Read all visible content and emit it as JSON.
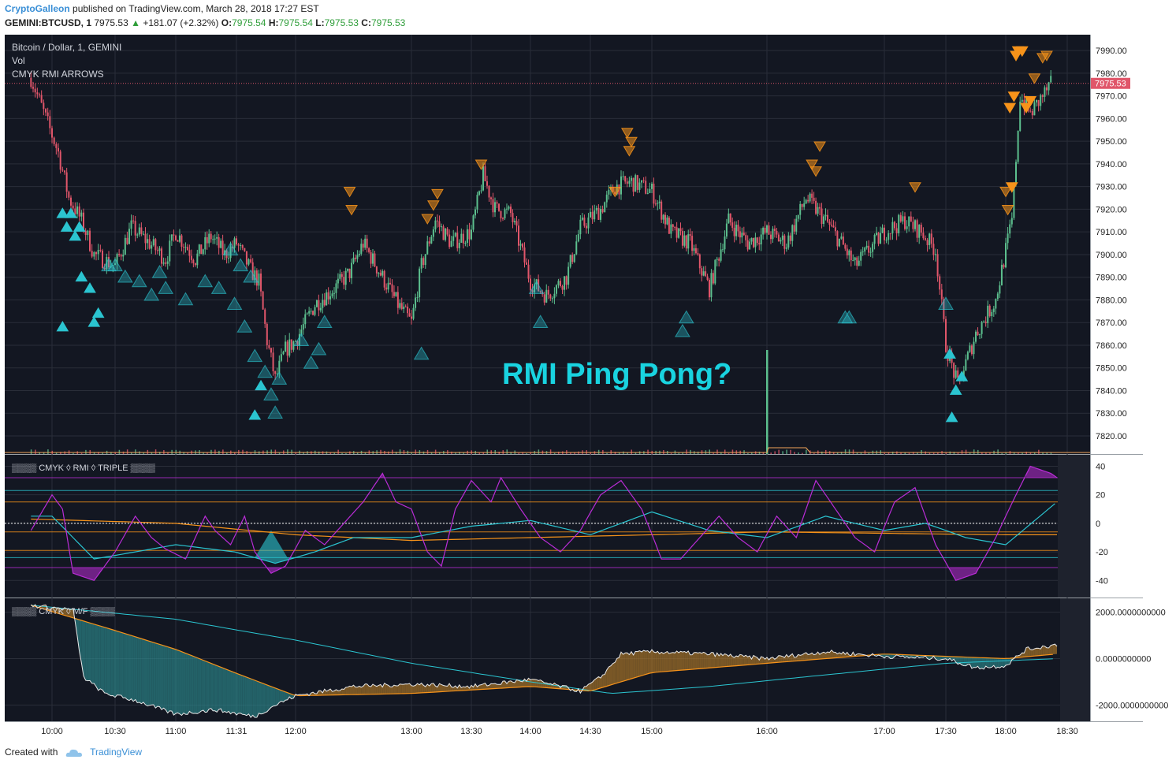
{
  "header": {
    "author": "CryptoGalleon",
    "published": "published on TradingView.com, March 28, 2018 17:27 EST",
    "symbol": "GEMINI:BTCUSD, 1",
    "last": "7975.53",
    "change": "+181.07 (+2.32%)",
    "o_label": "O:",
    "o": "7975.54",
    "h_label": "H:",
    "h": "7975.54",
    "l_label": "L:",
    "l": "7975.53",
    "c_label": "C:",
    "c": "7975.53"
  },
  "legend": {
    "main": "Bitcoin / Dollar, 1, GEMINI",
    "vol": "Vol",
    "indicator": "CMYK RMI ARROWS",
    "rmi": "▒▒▒▒ CMYK ◊ RMI ◊ TRIPLE ▒▒▒▒",
    "mf": "▒▒▒▒ CMYK ◊ M/F ▒▒▒▒"
  },
  "annotation": "RMI Ping Pong?",
  "footer": {
    "created": "Created with",
    "brand": "TradingView"
  },
  "colors": {
    "background": "#131722",
    "grid": "#2a2e39",
    "up": "#5cbf8e",
    "down": "#e0566a",
    "cyan": "#2bc4d0",
    "orange": "#f7931a",
    "magenta": "#b92cd6",
    "annotation": "#19d3e0",
    "last_price": "#e0566a"
  },
  "chart_data": [
    {
      "type": "candlestick",
      "title": "Bitcoin / Dollar, 1, GEMINI",
      "ylim": [
        7812,
        7997
      ],
      "y_ticks": [
        "7990.00",
        "7980.00",
        "7970.00",
        "7960.00",
        "7950.00",
        "7940.00",
        "7930.00",
        "7920.00",
        "7910.00",
        "7900.00",
        "7890.00",
        "7880.00",
        "7870.00",
        "7860.00",
        "7850.00",
        "7840.00",
        "7830.00",
        "7820.00"
      ],
      "x_ticks": [
        "10:00",
        "10:30",
        "11:00",
        "11:31",
        "12:00",
        "13:00",
        "13:30",
        "14:00",
        "14:30",
        "15:00",
        "16:00",
        "17:00",
        "17:30",
        "18:00",
        "18:30"
      ],
      "last_price_label": "7975.53",
      "close_path": [
        [
          "09:50",
          7978
        ],
        [
          "10:03",
          7945
        ],
        [
          "10:08",
          7925
        ],
        [
          "10:14",
          7915
        ],
        [
          "10:20",
          7900
        ],
        [
          "10:30",
          7895
        ],
        [
          "10:38",
          7912
        ],
        [
          "10:47",
          7905
        ],
        [
          "10:55",
          7898
        ],
        [
          "11:00",
          7910
        ],
        [
          "11:10",
          7898
        ],
        [
          "11:18",
          7908
        ],
        [
          "11:25",
          7900
        ],
        [
          "11:31",
          7905
        ],
        [
          "11:38",
          7893
        ],
        [
          "11:42",
          7888
        ],
        [
          "11:46",
          7862
        ],
        [
          "11:50",
          7845
        ],
        [
          "11:55",
          7858
        ],
        [
          "12:00",
          7862
        ],
        [
          "12:10",
          7878
        ],
        [
          "12:20",
          7885
        ],
        [
          "12:28",
          7892
        ],
        [
          "12:35",
          7905
        ],
        [
          "12:45",
          7890
        ],
        [
          "12:53",
          7878
        ],
        [
          "13:00",
          7870
        ],
        [
          "13:05",
          7895
        ],
        [
          "13:12",
          7915
        ],
        [
          "13:20",
          7905
        ],
        [
          "13:30",
          7910
        ],
        [
          "13:36",
          7935
        ],
        [
          "13:42",
          7920
        ],
        [
          "13:50",
          7918
        ],
        [
          "14:00",
          7888
        ],
        [
          "14:08",
          7882
        ],
        [
          "14:18",
          7890
        ],
        [
          "14:25",
          7912
        ],
        [
          "14:35",
          7920
        ],
        [
          "14:42",
          7930
        ],
        [
          "14:50",
          7932
        ],
        [
          "15:00",
          7928
        ],
        [
          "15:10",
          7910
        ],
        [
          "15:20",
          7905
        ],
        [
          "15:30",
          7885
        ],
        [
          "15:40",
          7915
        ],
        [
          "15:50",
          7905
        ],
        [
          "16:00",
          7910
        ],
        [
          "16:10",
          7905
        ],
        [
          "16:20",
          7925
        ],
        [
          "16:30",
          7915
        ],
        [
          "16:38",
          7905
        ],
        [
          "16:45",
          7895
        ],
        [
          "17:00",
          7910
        ],
        [
          "17:10",
          7915
        ],
        [
          "17:18",
          7910
        ],
        [
          "17:25",
          7902
        ],
        [
          "17:30",
          7860
        ],
        [
          "17:36",
          7842
        ],
        [
          "17:45",
          7865
        ],
        [
          "17:55",
          7880
        ],
        [
          "18:03",
          7915
        ],
        [
          "18:07",
          7970
        ],
        [
          "18:12",
          7962
        ],
        [
          "18:18",
          7970
        ],
        [
          "18:22",
          7975
        ]
      ],
      "volume_spike": {
        "x": "16:00",
        "value": "largest bar"
      }
    },
    {
      "type": "line",
      "title": "▒▒▒▒ CMYK ◊ RMI ◊ TRIPLE ▒▒▒▒",
      "ylim": [
        -52,
        48
      ],
      "y_ticks": [
        "40",
        "20",
        "0",
        "-20",
        "-40"
      ],
      "levels": [
        32,
        23,
        15,
        -6,
        -19,
        -24,
        -31
      ],
      "series": [
        {
          "role": "fast",
          "color": "#b92cd6",
          "points": [
            [
              "09:50",
              -5
            ],
            [
              "10:00",
              20
            ],
            [
              "10:05",
              10
            ],
            [
              "10:10",
              -35
            ],
            [
              "10:20",
              -40
            ],
            [
              "10:30",
              -20
            ],
            [
              "10:40",
              5
            ],
            [
              "10:48",
              -10
            ],
            [
              "10:55",
              -18
            ],
            [
              "11:05",
              -25
            ],
            [
              "11:15",
              5
            ],
            [
              "11:20",
              -5
            ],
            [
              "11:28",
              -15
            ],
            [
              "11:35",
              5
            ],
            [
              "11:40",
              -20
            ],
            [
              "11:48",
              -35
            ],
            [
              "11:55",
              -30
            ],
            [
              "12:05",
              -5
            ],
            [
              "12:15",
              -15
            ],
            [
              "12:25",
              0
            ],
            [
              "12:35",
              15
            ],
            [
              "12:45",
              35
            ],
            [
              "12:52",
              15
            ],
            [
              "13:00",
              10
            ],
            [
              "13:08",
              -20
            ],
            [
              "13:15",
              -30
            ],
            [
              "13:22",
              10
            ],
            [
              "13:30",
              30
            ],
            [
              "13:40",
              15
            ],
            [
              "13:45",
              32
            ],
            [
              "13:55",
              10
            ],
            [
              "14:05",
              -10
            ],
            [
              "14:15",
              -20
            ],
            [
              "14:25",
              -5
            ],
            [
              "14:35",
              20
            ],
            [
              "14:45",
              30
            ],
            [
              "14:55",
              10
            ],
            [
              "15:05",
              -25
            ],
            [
              "15:15",
              -25
            ],
            [
              "15:25",
              -10
            ],
            [
              "15:35",
              5
            ],
            [
              "15:45",
              -10
            ],
            [
              "15:55",
              -20
            ],
            [
              "16:05",
              5
            ],
            [
              "16:15",
              -10
            ],
            [
              "16:25",
              30
            ],
            [
              "16:35",
              10
            ],
            [
              "16:45",
              -10
            ],
            [
              "16:55",
              -20
            ],
            [
              "17:05",
              15
            ],
            [
              "17:15",
              25
            ],
            [
              "17:25",
              -15
            ],
            [
              "17:35",
              -40
            ],
            [
              "17:45",
              -35
            ],
            [
              "17:55",
              -10
            ],
            [
              "18:05",
              20
            ],
            [
              "18:12",
              40
            ],
            [
              "18:22",
              35
            ],
            [
              "18:25",
              32
            ]
          ]
        },
        {
          "role": "slow",
          "color": "#2bc4d0",
          "points": [
            [
              "09:50",
              5
            ],
            [
              "10:00",
              5
            ],
            [
              "10:20",
              -25
            ],
            [
              "10:40",
              -20
            ],
            [
              "11:00",
              -15
            ],
            [
              "11:30",
              -20
            ],
            [
              "11:50",
              -28
            ],
            [
              "12:10",
              -20
            ],
            [
              "12:30",
              -10
            ],
            [
              "13:00",
              -10
            ],
            [
              "13:30",
              -2
            ],
            [
              "14:00",
              2
            ],
            [
              "14:30",
              -8
            ],
            [
              "15:00",
              8
            ],
            [
              "15:30",
              -5
            ],
            [
              "16:00",
              -10
            ],
            [
              "16:30",
              5
            ],
            [
              "17:00",
              -5
            ],
            [
              "17:20",
              0
            ],
            [
              "17:40",
              -10
            ],
            [
              "18:00",
              -15
            ],
            [
              "18:25",
              15
            ]
          ]
        },
        {
          "role": "trend",
          "color": "#f7931a",
          "points": [
            [
              "09:50",
              3
            ],
            [
              "11:00",
              0
            ],
            [
              "12:00",
              -8
            ],
            [
              "13:00",
              -12
            ],
            [
              "14:00",
              -10
            ],
            [
              "15:00",
              -8
            ],
            [
              "16:00",
              -6
            ],
            [
              "17:00",
              -7
            ],
            [
              "18:00",
              -8
            ],
            [
              "18:25",
              -8
            ]
          ]
        }
      ]
    },
    {
      "type": "area",
      "title": "▒▒▒▒ CMYK ◊ M/F ▒▒▒▒",
      "ylim": [
        -2700,
        2600
      ],
      "y_ticks": [
        "2000.0000000000",
        "0.0000000000",
        "-2000.0000000000"
      ],
      "series": [
        {
          "role": "flow",
          "color": "#e8e8e8",
          "points": [
            [
              "09:50",
              2300
            ],
            [
              "10:00",
              2200
            ],
            [
              "10:10",
              2100
            ],
            [
              "10:15",
              -800
            ],
            [
              "10:25",
              -1500
            ],
            [
              "10:40",
              -1800
            ],
            [
              "11:00",
              -2400
            ],
            [
              "11:20",
              -2200
            ],
            [
              "11:40",
              -2500
            ],
            [
              "11:50",
              -2000
            ],
            [
              "12:00",
              -1600
            ],
            [
              "12:30",
              -1200
            ],
            [
              "13:00",
              -1100
            ],
            [
              "13:30",
              -1200
            ],
            [
              "14:00",
              -900
            ],
            [
              "14:15",
              -1200
            ],
            [
              "14:25",
              -1400
            ],
            [
              "14:35",
              -800
            ],
            [
              "14:45",
              200
            ],
            [
              "15:00",
              300
            ],
            [
              "15:30",
              200
            ],
            [
              "16:00",
              0
            ],
            [
              "16:30",
              300
            ],
            [
              "17:00",
              100
            ],
            [
              "17:30",
              0
            ],
            [
              "17:45",
              -400
            ],
            [
              "18:00",
              -300
            ],
            [
              "18:10",
              400
            ],
            [
              "18:25",
              600
            ]
          ]
        },
        {
          "role": "average",
          "color": "#f7931a",
          "points": [
            [
              "09:50",
              2300
            ],
            [
              "11:00",
              400
            ],
            [
              "12:00",
              -1600
            ],
            [
              "13:00",
              -1500
            ],
            [
              "14:00",
              -1200
            ],
            [
              "14:30",
              -1400
            ],
            [
              "15:00",
              -600
            ],
            [
              "16:00",
              -200
            ],
            [
              "17:00",
              200
            ],
            [
              "18:00",
              0
            ],
            [
              "18:25",
              200
            ]
          ]
        },
        {
          "role": "signal",
          "color": "#2bc4d0",
          "points": [
            [
              "09:50",
              2300
            ],
            [
              "11:00",
              1700
            ],
            [
              "12:00",
              800
            ],
            [
              "13:00",
              -200
            ],
            [
              "14:00",
              -1000
            ],
            [
              "14:40",
              -1500
            ],
            [
              "15:30",
              -1200
            ],
            [
              "16:30",
              -700
            ],
            [
              "17:30",
              -200
            ],
            [
              "18:25",
              0
            ]
          ]
        }
      ]
    }
  ]
}
